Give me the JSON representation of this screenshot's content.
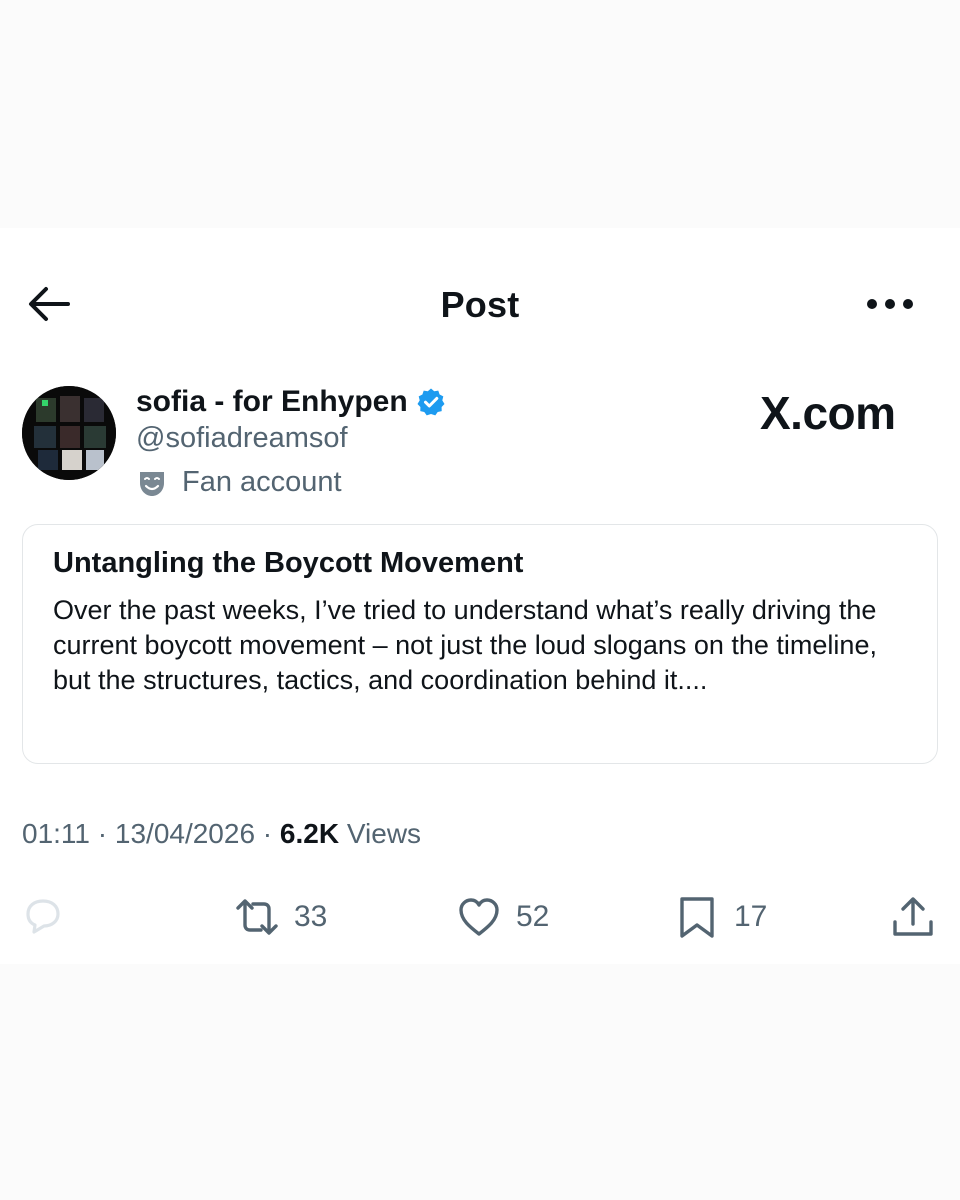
{
  "header": {
    "title": "Post"
  },
  "author": {
    "name": "sofia - for Enhypen",
    "handle": "@sofiadreamsof",
    "label": "Fan account",
    "verified": true
  },
  "brand": "X.com",
  "article": {
    "title": "Untangling the Boycott Movement",
    "preview": "Over the past weeks, I’ve tried to understand what’s really driving the current boycott movement – not just the loud slogans on the timeline, but the structures, tactics, and coordination behind it...."
  },
  "meta": {
    "time": "01:11",
    "sep1": " · ",
    "date": "13/04/2026",
    "sep2": " · ",
    "views_count": "6.2K",
    "views_label": " Views"
  },
  "actions": {
    "reply": "",
    "repost": "33",
    "like": "52",
    "bookmark": "17"
  },
  "colors": {
    "text": "#0f1419",
    "secondary": "#536471",
    "verified": "#1d9bf0",
    "border": "#e3e6e8"
  }
}
